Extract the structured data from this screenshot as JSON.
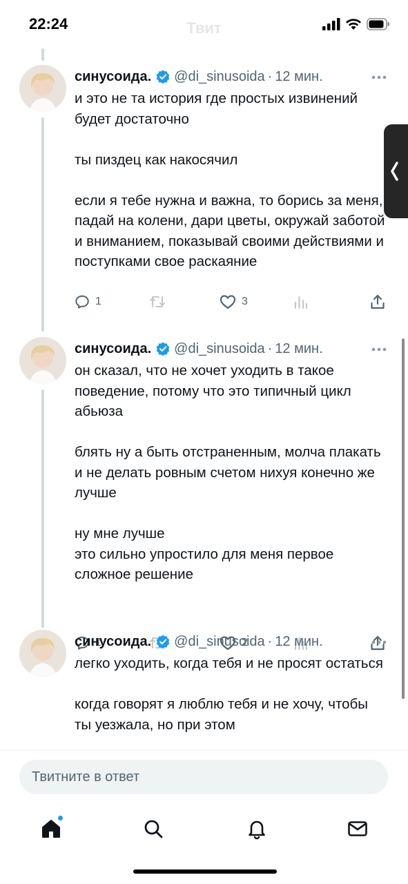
{
  "status_bar": {
    "time": "22:24",
    "title": "Твит"
  },
  "colors": {
    "accent": "#1d9bf0",
    "text": "#0f1419",
    "secondary": "#536471"
  },
  "thread": [
    {
      "name": "синусоида.",
      "handle": "@di_sinusoida",
      "dot": "·",
      "time": "12 мин.",
      "paragraphs": [
        "и это не та история где простых извинений будет достаточно",
        "ты пиздец как накосячил",
        "если я тебе нужна и важна, то борись за меня, падай на колени, дари цветы, окружай заботой и вниманием, показывай своими действиями и поступками свое раскаяние"
      ],
      "replies": "1",
      "likes": "3"
    },
    {
      "name": "синусоида.",
      "handle": "@di_sinusoida",
      "dot": "·",
      "time": "12 мин.",
      "paragraphs": [
        "он сказал, что не хочет уходить в такое поведение, потому что это типичный цикл абьюза",
        "блять ну а быть отстраненным, молча плакать и не делать ровным счетом нихуя конечно же лучше",
        "ну мне лучше\nэто сильно упростило для меня первое сложное решение"
      ],
      "replies": "1",
      "likes": "2"
    },
    {
      "name": "синусоида.",
      "handle": "@di_sinusoida",
      "dot": "·",
      "time": "12 мин.",
      "paragraphs": [
        "легко уходить, когда тебя и не просят остаться",
        "когда говорят я люблю тебя и не хочу, чтобы ты уезжала, но при этом"
      ]
    }
  ],
  "reply": {
    "placeholder": "Твитните в ответ"
  },
  "tabs": [
    "home-icon",
    "search-icon",
    "bell-icon",
    "mail-icon"
  ]
}
